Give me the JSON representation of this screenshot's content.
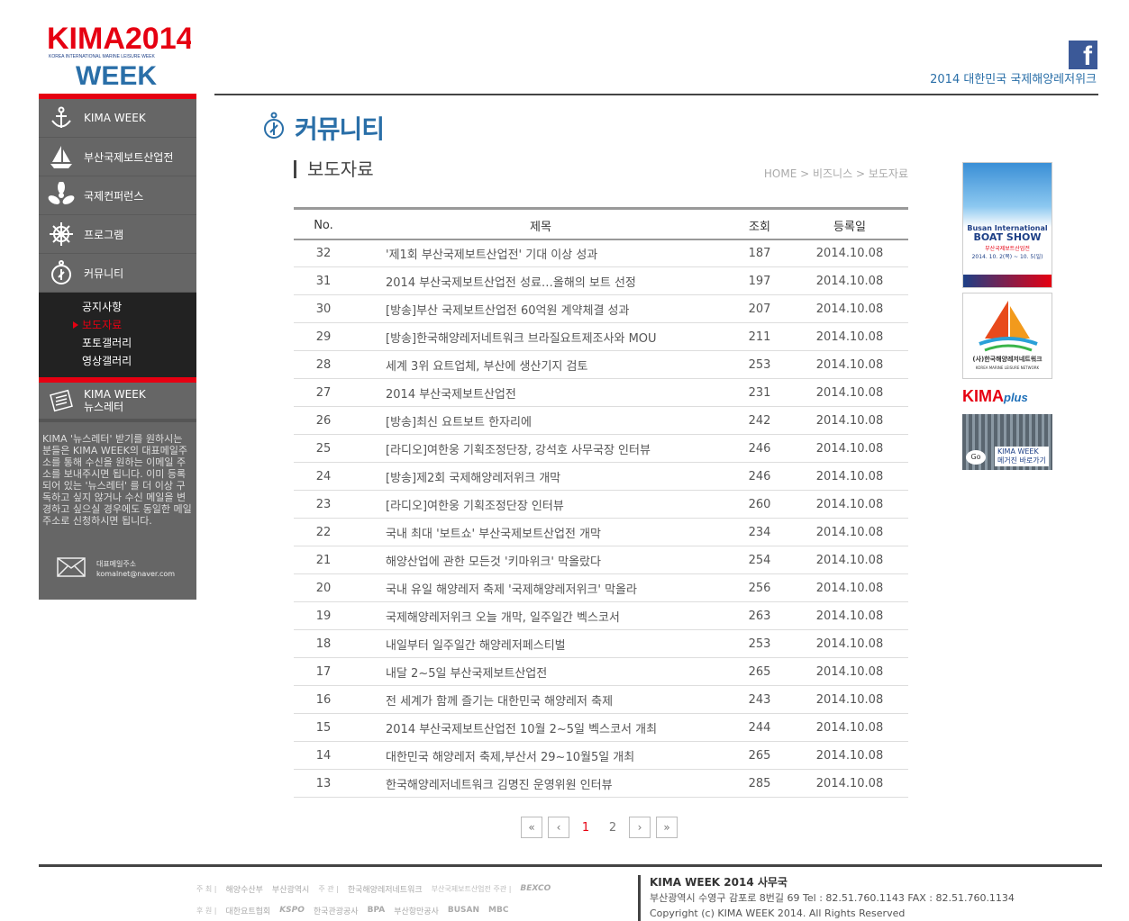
{
  "brand": {
    "logo_top": "KIMA2014",
    "logo_sub": "KOREA INTERNATIONAL MARINE LEISURE WEEK",
    "logo_bottom": "WEEK",
    "site_title": "2014 대한민국 국제해양레저위크",
    "facebook": "f"
  },
  "sidebar": {
    "items": [
      {
        "label": "KIMA WEEK",
        "icon": "anchor-icon"
      },
      {
        "label": "부산국제보트산업전",
        "icon": "sailboat-icon"
      },
      {
        "label": "국제컨퍼런스",
        "icon": "propeller-icon"
      },
      {
        "label": "프로그램",
        "icon": "helm-icon"
      },
      {
        "label": "커뮤니티",
        "icon": "compass-icon"
      }
    ],
    "sub_items": [
      {
        "label": "공지사항",
        "active": false
      },
      {
        "label": "보도자료",
        "active": true
      },
      {
        "label": "포토갤러리",
        "active": false
      },
      {
        "label": "영상갤러리",
        "active": false
      }
    ],
    "newsletter": {
      "title_line1": "KIMA WEEK",
      "title_line2": "뉴스레터",
      "text": "KIMA '뉴스레터' 받기를 원하시는 분들은 KIMA WEEK의 대표메일주소를 통해 수신을 원하는 이메일 주소를 보내주시면 됩니다. 이미 등록되어 있는 '뉴스레터' 를 더 이상 구독하고 싶지 않거나 수신 메일을 변경하고 싶으실 경우에도 동일한 메일주소로 신청하시면 됩니다.",
      "mail_label": "대표메일주소",
      "mail_address": "komalnet@naver.com"
    }
  },
  "main": {
    "page_title": "커뮤니티",
    "section_title": "보도자료",
    "breadcrumb": [
      "HOME",
      "비즈니스",
      "보도자료"
    ],
    "table": {
      "headers": {
        "no": "No.",
        "title": "제목",
        "hits": "조회",
        "date": "등록일"
      },
      "rows": [
        {
          "no": "32",
          "title": "'제1회 부산국제보트산업전' 기대 이상 성과",
          "hits": "187",
          "date": "2014.10.08"
        },
        {
          "no": "31",
          "title": "2014 부산국제보트산업전 성료…올해의 보트 선정",
          "hits": "197",
          "date": "2014.10.08"
        },
        {
          "no": "30",
          "title": "[방송]부산 국제보트산업전 60억원 계약체결 성과",
          "hits": "207",
          "date": "2014.10.08"
        },
        {
          "no": "29",
          "title": "[방송]한국해양레저네트워크 브라질요트제조사와 MOU",
          "hits": "211",
          "date": "2014.10.08"
        },
        {
          "no": "28",
          "title": "세계 3위 요트업체, 부산에 생산기지 검토",
          "hits": "253",
          "date": "2014.10.08"
        },
        {
          "no": "27",
          "title": "2014 부산국제보트산업전",
          "hits": "231",
          "date": "2014.10.08"
        },
        {
          "no": "26",
          "title": "[방송]최신 요트보트 한자리에",
          "hits": "242",
          "date": "2014.10.08"
        },
        {
          "no": "25",
          "title": "[라디오]여한웅 기획조정단장, 강석호 사무국장 인터뷰",
          "hits": "246",
          "date": "2014.10.08"
        },
        {
          "no": "24",
          "title": "[방송]제2회 국제해양레저위크 개막",
          "hits": "246",
          "date": "2014.10.08"
        },
        {
          "no": "23",
          "title": "[라디오]여한웅 기획조정단장 인터뷰",
          "hits": "260",
          "date": "2014.10.08"
        },
        {
          "no": "22",
          "title": "국내 최대 '보트쇼' 부산국제보트산업전 개막",
          "hits": "234",
          "date": "2014.10.08"
        },
        {
          "no": "21",
          "title": "해양산업에 관한 모든것 '키마위크' 막올랐다",
          "hits": "254",
          "date": "2014.10.08"
        },
        {
          "no": "20",
          "title": "국내 유일 해양레저 축제 '국제해양레저위크' 막올라",
          "hits": "256",
          "date": "2014.10.08"
        },
        {
          "no": "19",
          "title": "국제해양레저위크 오늘 개막, 일주일간 벡스코서",
          "hits": "263",
          "date": "2014.10.08"
        },
        {
          "no": "18",
          "title": "내일부터 일주일간 해양레저페스티벌",
          "hits": "253",
          "date": "2014.10.08"
        },
        {
          "no": "17",
          "title": "내달 2~5일 부산국제보트산업전",
          "hits": "265",
          "date": "2014.10.08"
        },
        {
          "no": "16",
          "title": "전 세계가 함께 즐기는 대한민국 해양레저 축제",
          "hits": "243",
          "date": "2014.10.08"
        },
        {
          "no": "15",
          "title": "2014 부산국제보트산업전 10월 2~5일 벡스코서 개최",
          "hits": "244",
          "date": "2014.10.08"
        },
        {
          "no": "14",
          "title": "대한민국 해양레저 축제,부산서 29~10월5일 개최",
          "hits": "265",
          "date": "2014.10.08"
        },
        {
          "no": "13",
          "title": "한국해양레저네트워크 김명진 운영위원 인터뷰",
          "hits": "285",
          "date": "2014.10.08"
        }
      ]
    },
    "pagination": {
      "first": "«",
      "prev": "‹",
      "pages": [
        "1",
        "2"
      ],
      "current": "1",
      "next": "›",
      "last": "»"
    }
  },
  "banners": {
    "boatshow_line1": "Busan International",
    "boatshow_line2": "BOAT SHOW",
    "boatshow_kr": "부산국제보트산업전",
    "boatshow_date": "2014. 10. 2(목) ~ 10. 5(일)",
    "network_kr": "(사)한국해양레저네트워크",
    "network_en": "KOREA MARINE LEISURE NETWORK",
    "kimaplus_top": "KIMA",
    "kimaplus_plus": "plus",
    "kimaplus_go": "Go",
    "kimaplus_lbl1": "KIMA WEEK",
    "kimaplus_lbl2": "메거진 바로가기"
  },
  "footer": {
    "org_title": "KIMA WEEK 2014 사무국",
    "address": "부산광역시 수영구 감포로 8번길 69 Tel : 82.51.760.1143 FAX : 82.51.760.1134",
    "copyright": "Copyright (c) KIMA WEEK 2014. All Rights Reserved",
    "row1": [
      "주 최 |",
      "해양수산부",
      "부산광역시",
      "주 관 |",
      "한국해양레저네트워크",
      "부산국제보트산업전 주관 |",
      "BEXCO"
    ],
    "row2": [
      "후 원 |",
      "대한요트협회",
      "KSPO",
      "한국관광공사",
      "BPA",
      "부산항만공사",
      "BUSAN",
      "MBC"
    ]
  }
}
